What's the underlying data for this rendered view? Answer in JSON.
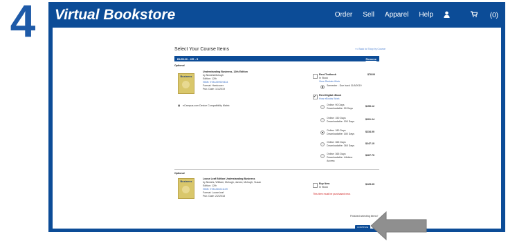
{
  "step": "4",
  "header": {
    "brand": "Virtual Bookstore",
    "nav": [
      "Order",
      "Sell",
      "Apparel",
      "Help"
    ],
    "cart": "(0)"
  },
  "page": {
    "title": "Select Your Course Items",
    "back_link": "<< Back to Shop by Course",
    "course_code": "BUS100 - HR - 5",
    "remove_label": "Remove",
    "optional_label": "Optional",
    "finished_text": "Finished selecting items?",
    "continue_label": "CONTINUE"
  },
  "item1": {
    "cover_title": "Business",
    "title": "Understanding Business, 12th Edition",
    "author": "by Nickels/Mchugh",
    "edition": "Edition: 12th",
    "isbn": "ISBN: 9781259929434",
    "format": "Format: Hardcover",
    "pub_date": "Pub. Date: 1/1/2019",
    "compat": "eCampus.com Device Compatibility Matrix",
    "rent_textbook": {
      "label": "Rent Textbook",
      "stock": "In Stock",
      "link": "View Rentals Work",
      "price": "$78.00",
      "term": "Semester - Due back 11/6/2019"
    },
    "rent_ebook": {
      "label": "Rent Digital eBook",
      "link": "How eBooks Work"
    },
    "ebook_options": [
      {
        "name": "Online: 90 Days",
        "sub": "Downloadable: 90 Days",
        "price": "$159.12",
        "selected": false
      },
      {
        "name": "Online: 150 Days",
        "sub": "Downloadable: 150 Days",
        "price": "$201.24",
        "selected": false
      },
      {
        "name": "Online: 180 Days",
        "sub": "Downloadable: 180 Days",
        "price": "$234.00",
        "selected": true
      },
      {
        "name": "Online: 365 Days",
        "sub": "Downloadable: 365 Days",
        "price": "$247.10",
        "selected": false
      },
      {
        "name": "Online: 365 Days",
        "sub": "Downloadable: Lifetime",
        "sub2": "Access",
        "price": "$267.70",
        "selected": false
      }
    ]
  },
  "item2": {
    "cover_title": "Business",
    "title": "Loose Leaf Edition Understanding Business",
    "author": "by Nickels, William; Mchugh, James; Mchugh, Susan",
    "edition": "Edition: 12th",
    "isbn": "ISBN: 9781260211139",
    "format": "Format: Loose-leaf",
    "pub_date": "Pub. Date: 2/2/2018",
    "buy_new": {
      "label": "Buy New",
      "stock": "In Stock",
      "price": "$125.69"
    },
    "notice": "This item must be purchased new."
  },
  "colors": {
    "brand_blue": "#0c4c97",
    "accent_blue": "#1e5aa8",
    "notice_red": "#cc1111"
  }
}
